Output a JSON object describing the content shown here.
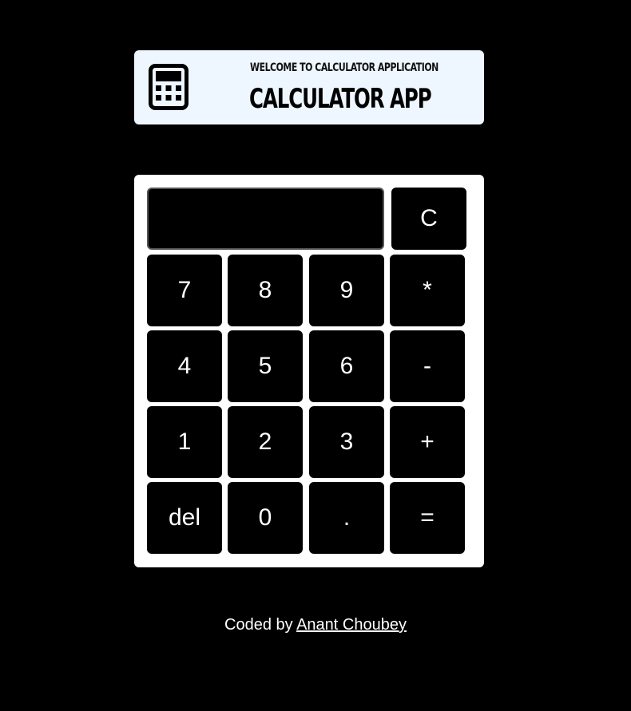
{
  "header": {
    "subtitle": "Welcome to Calculator Application",
    "title": "Calculator App",
    "icon": "calculator-icon"
  },
  "display": {
    "value": ""
  },
  "buttons": {
    "clear": "C",
    "seven": "7",
    "eight": "8",
    "nine": "9",
    "multiply": "*",
    "four": "4",
    "five": "5",
    "six": "6",
    "subtract": "-",
    "one": "1",
    "two": "2",
    "three": "3",
    "add": "+",
    "delete": "del",
    "zero": "0",
    "decimal": ".",
    "equals": "="
  },
  "footer": {
    "prefix": "Coded by",
    "author": "Anant Choubey"
  },
  "colors": {
    "background": "#000000",
    "header_bg": "#eef7ff",
    "panel_bg": "#ffffff",
    "button_bg": "#000000",
    "button_text": "#ffffff"
  }
}
